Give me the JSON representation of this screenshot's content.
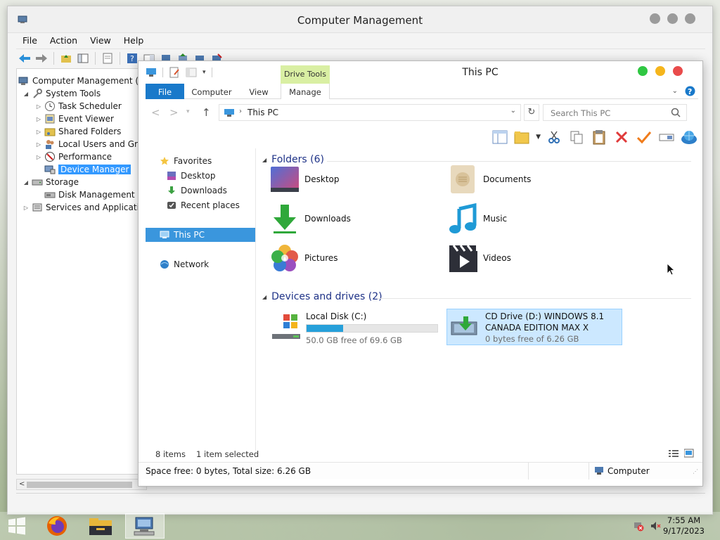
{
  "outer_window": {
    "title": "Computer Management",
    "menu": [
      "File",
      "Action",
      "View",
      "Help"
    ],
    "tree": [
      {
        "label": "Computer Management (Lo",
        "level": 0,
        "expander": ""
      },
      {
        "label": "System Tools",
        "level": 1,
        "expander": "◢"
      },
      {
        "label": "Task Scheduler",
        "level": 2,
        "expander": "▷"
      },
      {
        "label": "Event Viewer",
        "level": 2,
        "expander": "▷"
      },
      {
        "label": "Shared Folders",
        "level": 2,
        "expander": "▷"
      },
      {
        "label": "Local Users and Grou",
        "level": 2,
        "expander": "▷"
      },
      {
        "label": "Performance",
        "level": 2,
        "expander": "▷"
      },
      {
        "label": "Device Manager",
        "level": 2,
        "expander": "",
        "selected": true
      },
      {
        "label": "Storage",
        "level": 1,
        "expander": "◢"
      },
      {
        "label": "Disk Management",
        "level": 2,
        "expander": ""
      },
      {
        "label": "Services and Application",
        "level": 1,
        "expander": "▷"
      }
    ]
  },
  "pc_window": {
    "title": "This PC",
    "contextual_tab": "Drive Tools",
    "tabs": [
      "File",
      "Computer",
      "View",
      "Manage"
    ],
    "address": "This PC",
    "search_placeholder": "Search This PC",
    "nav": {
      "favorites": "Favorites",
      "desktop": "Desktop",
      "downloads": "Downloads",
      "recent": "Recent places",
      "this_pc": "This PC",
      "network": "Network"
    },
    "folders_heading": "Folders (6)",
    "folders": [
      {
        "label": "Desktop",
        "icon": "desktop-folder-icon"
      },
      {
        "label": "Documents",
        "icon": "documents-folder-icon"
      },
      {
        "label": "Downloads",
        "icon": "downloads-folder-icon"
      },
      {
        "label": "Music",
        "icon": "music-folder-icon"
      },
      {
        "label": "Pictures",
        "icon": "pictures-folder-icon"
      },
      {
        "label": "Videos",
        "icon": "videos-folder-icon"
      }
    ],
    "drives_heading": "Devices and drives (2)",
    "drives": [
      {
        "name": "Local Disk (C:)",
        "free": "50.0 GB free of 69.6 GB",
        "used_fraction": 0.282
      },
      {
        "name": "CD Drive (D:) WINDOWS 8.1",
        "name2": "CANADA EDITION MAX X",
        "free": "0 bytes free of 6.26 GB"
      }
    ],
    "status_items": "8 items",
    "status_selected": "1 item selected",
    "detail_space": "Space free: 0 bytes, Total size: 6.26 GB",
    "detail_location": "Computer"
  },
  "taskbar": {
    "time": "7:55 AM",
    "date": "9/17/2023"
  },
  "colors": {
    "accent": "#1979ca",
    "selection": "#3a96dd",
    "drive_fill": "#26a0da",
    "close": "#e94b4b",
    "minimize": "#f5b51c",
    "maximize": "#2fc742"
  }
}
